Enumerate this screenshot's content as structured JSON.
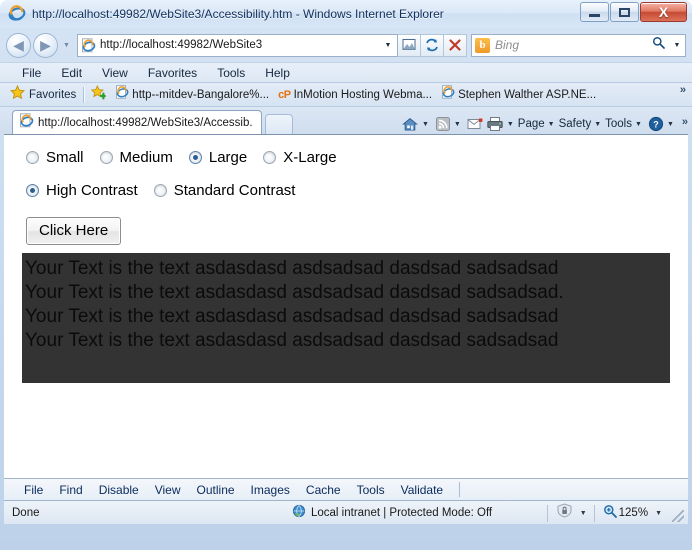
{
  "window": {
    "title": "http://localhost:49982/WebSite3/Accessibility.htm - Windows Internet Explorer",
    "minimize_label": "Minimize",
    "maximize_label": "Maximize",
    "close_label": "X"
  },
  "nav": {
    "back_label": "◄",
    "forward_label": "►",
    "recent_caret": "▼",
    "address_value": "http://localhost:49982/WebSite3",
    "address_placeholder": "http://localhost:49982/WebSite3",
    "address_caret": "▼",
    "compat_icon": "compatibility-view-icon",
    "refresh_icon": "refresh-icon",
    "stop_icon": "stop-icon",
    "search_placeholder": "Bing",
    "search_value": "",
    "search_provider": "b",
    "search_caret": "▼"
  },
  "menubar": {
    "items": [
      {
        "label": "File"
      },
      {
        "label": "Edit"
      },
      {
        "label": "View"
      },
      {
        "label": "Favorites"
      },
      {
        "label": "Tools"
      },
      {
        "label": "Help"
      }
    ]
  },
  "favorites_bar": {
    "favorites_label": "Favorites",
    "add_label": "Add to Favorites Bar",
    "links": [
      {
        "label": "http--mitdev-Bangalore%...",
        "icon": "ie-page-icon"
      },
      {
        "label": "InMotion Hosting Webma...",
        "icon": "cpanel-icon"
      },
      {
        "label": "Stephen Walther  ASP.NE...",
        "icon": "ie-page-icon"
      }
    ],
    "overflow": "»"
  },
  "tabs": {
    "items": [
      {
        "label": "http://localhost:49982/WebSite3/Accessib...",
        "active": true
      }
    ],
    "new_tab_label": "New Tab"
  },
  "command_bar": {
    "home_icon": "home-icon",
    "feeds_icon": "feeds-icon",
    "mail_icon": "read-mail-icon",
    "print_icon": "print-icon",
    "items": [
      {
        "label": "Page"
      },
      {
        "label": "Safety"
      },
      {
        "label": "Tools"
      }
    ],
    "help_icon": "help-icon",
    "caret": "▼",
    "overflow": "»"
  },
  "page": {
    "size_group": {
      "name": "font-size",
      "options": [
        {
          "label": "Small",
          "checked": false
        },
        {
          "label": "Medium",
          "checked": false
        },
        {
          "label": "Large",
          "checked": true
        },
        {
          "label": "X-Large",
          "checked": false
        }
      ]
    },
    "contrast_group": {
      "name": "contrast",
      "options": [
        {
          "label": "High Contrast",
          "checked": true
        },
        {
          "label": "Standard Contrast",
          "checked": false
        }
      ]
    },
    "submit_button": "Click Here",
    "output_panel": {
      "background": "#333333",
      "text_color": "#0b0b0b",
      "lines": [
        "Your Text is the text asdasdasd asdsadsad dasdsad sadsadsad",
        "Your Text is the text asdasdasd asdsadsad dasdsad sadsadsad.",
        "Your Text is the text asdasdasd asdsadsad dasdsad sadsadsad",
        "Your Text is the text asdasdasd asdsadsad dasdsad sadsadsad"
      ]
    }
  },
  "developer_toolbar": {
    "items": [
      {
        "label": "File"
      },
      {
        "label": "Find"
      },
      {
        "label": "Disable"
      },
      {
        "label": "View"
      },
      {
        "label": "Outline"
      },
      {
        "label": "Images"
      },
      {
        "label": "Cache"
      },
      {
        "label": "Tools"
      },
      {
        "label": "Validate"
      }
    ]
  },
  "status_bar": {
    "status": "Done",
    "zone": "Local intranet | Protected Mode: Off",
    "zone_icon": "internet-zone-icon",
    "protected_icon": "protected-mode-icon",
    "zoom_level": "125%",
    "zoom_icon": "zoom-icon",
    "caret": "▼"
  }
}
